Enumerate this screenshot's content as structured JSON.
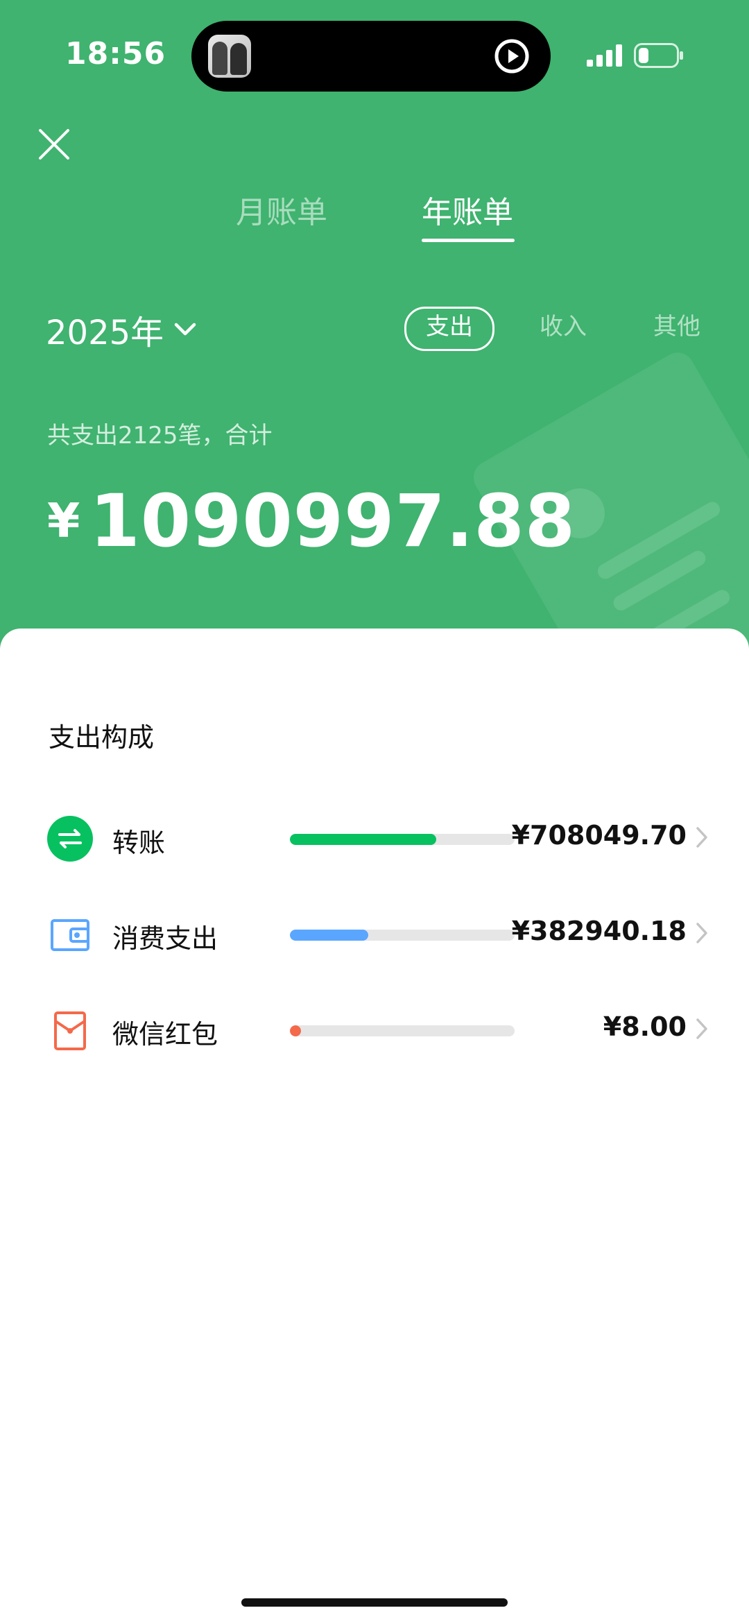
{
  "status_bar": {
    "time": "18:56"
  },
  "tabs": {
    "month": "月账单",
    "year": "年账单",
    "active": "year"
  },
  "year_picker": {
    "label": "2025年"
  },
  "filters": {
    "expense": "支出",
    "income": "收入",
    "other": "其他",
    "active": "expense"
  },
  "summary": {
    "text": "共支出2125笔，合计",
    "currency": "¥",
    "total": "1090997.88"
  },
  "composition": {
    "title": "支出构成",
    "items": [
      {
        "label": "转账",
        "amount": "¥708049.70",
        "fraction": 0.65,
        "color": "#07c160",
        "icon": "transfer-icon"
      },
      {
        "label": "消费支出",
        "amount": "¥382940.18",
        "fraction": 0.35,
        "color": "#5aa6ff",
        "icon": "wallet-icon"
      },
      {
        "label": "微信红包",
        "amount": "¥8.00",
        "fraction": 0.0,
        "color": "#f4694a",
        "icon": "red-packet-icon"
      }
    ]
  },
  "colors": {
    "header_green": "#3fb36f",
    "accent_green": "#07c160"
  }
}
